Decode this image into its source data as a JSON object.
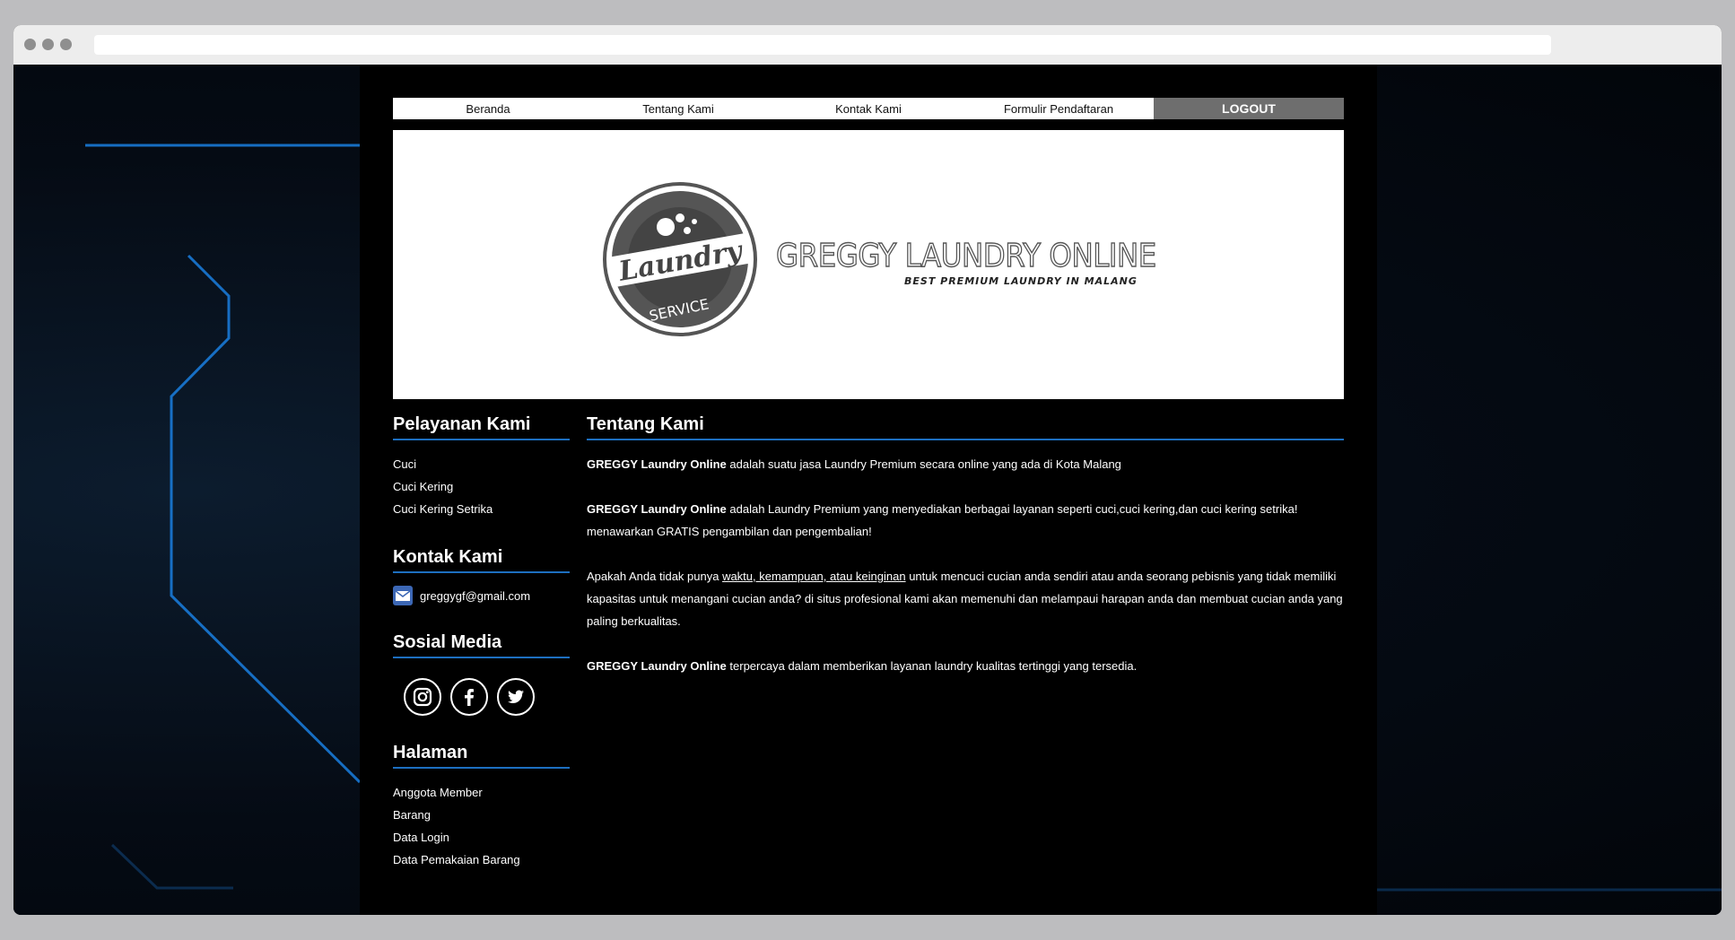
{
  "nav": {
    "items": [
      "Beranda",
      "Tentang Kami",
      "Kontak Kami",
      "Formulir Pendaftaran"
    ],
    "logout": "LOGOUT"
  },
  "banner": {
    "title": "GREGGY LAUNDRY ONLINE",
    "tagline": "BEST PREMIUM LAUNDRY IN MALANG",
    "logo_text": "Laundry",
    "logo_sub": "SERVICE"
  },
  "sidebar": {
    "services": {
      "heading": "Pelayanan Kami",
      "items": [
        "Cuci",
        "Cuci Kering",
        "Cuci Kering Setrika"
      ]
    },
    "contact": {
      "heading": "Kontak Kami",
      "email": "greggygf@gmail.com"
    },
    "social": {
      "heading": "Sosial Media",
      "icons": [
        "instagram-icon",
        "facebook-icon",
        "twitter-icon"
      ]
    },
    "pages": {
      "heading": "Halaman",
      "items": [
        "Anggota Member",
        "Barang",
        "Data Login",
        "Data Pemakaian Barang"
      ]
    }
  },
  "main": {
    "heading": "Tentang Kami",
    "p1": {
      "brand": "GREGGY Laundry Online",
      "text": " adalah suatu jasa Laundry Premium secara online yang ada di Kota Malang"
    },
    "p2": {
      "brand": "GREGGY Laundry Online",
      "text": " adalah Laundry Premium yang menyediakan berbagai layanan seperti cuci,cuci kering,dan cuci kering setrika! menawarkan GRATIS pengambilan dan pengembalian!"
    },
    "p3": {
      "before": "Apakah Anda tidak punya ",
      "link": "waktu, kemampuan, atau keinginan",
      "after": " untuk mencuci cucian anda sendiri atau anda seorang pebisnis yang tidak memiliki kapasitas untuk menangani cucian anda? di situs profesional kami akan memenuhi dan melampaui harapan anda dan membuat cucian anda yang paling berkualitas."
    },
    "p4": {
      "brand": "GREGGY Laundry Online",
      "text": " terpercaya dalam memberikan layanan laundry kualitas tertinggi yang tersedia."
    }
  },
  "colors": {
    "accent": "#1d6fc0",
    "logout_bg": "#6e6e6e",
    "page_bg": "#000000"
  }
}
